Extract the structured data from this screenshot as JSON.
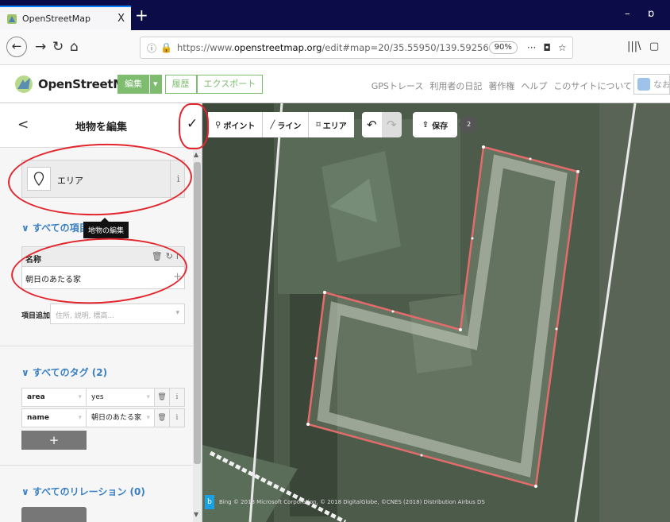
{
  "browser": {
    "tab_title": "OpenStreetMap",
    "tab_close": "X",
    "new_tab": "+",
    "url_host_prefix": "https://www.",
    "url_host": "openstreetmap.org",
    "url_path": "/edit#map=20/35.55950/139.59256",
    "zoom": "90%",
    "actions_menu": "···",
    "window_minimize": "–",
    "window_restore": "ɒ"
  },
  "osm": {
    "logo_text": "OpenStreetMap",
    "edit_button": "編集",
    "edit_dropdown": "▾",
    "history_button": "履歴",
    "export_button": "エクスポート",
    "header_links": [
      "GPSトレース",
      "利用者の日記",
      "著作権",
      "ヘルプ",
      "このサイトについて"
    ],
    "user_name": "なおや"
  },
  "sidebar": {
    "back": "<",
    "title": "地物を編集",
    "done": "✓",
    "preset_label": "エリア",
    "preset_info": "i",
    "section_all_fields": "∨ すべての項目",
    "tooltip": "地物の編集",
    "field_label": "名称",
    "field_value": "朝日のあたる家",
    "field_icons": "🗑↻i",
    "field_plus": "+",
    "add_field_label": "項目追加:",
    "add_field_placeholder": "住所, 説明, 標高...",
    "section_tags": "∨ すべてのタグ (2)",
    "tags": [
      {
        "key": "area",
        "value": "yes"
      },
      {
        "key": "name",
        "value": "朝日のあたる家"
      }
    ],
    "tag_delete": "🗑",
    "tag_info": "i",
    "add_tag": "+",
    "section_relations": "∨ すべてのリレーション (0)"
  },
  "map": {
    "tool_point": "ポイント",
    "tool_line": "ライン",
    "tool_area": "エリア",
    "undo": "↶",
    "redo": "↷",
    "save": "保存",
    "save_count": "2",
    "attribution_logo": "b",
    "attribution": "Bing © 2018 Microsoft Corporation, © 2018 DigitalGlobe, ©CNES (2018) Distribution Airbus DS"
  }
}
